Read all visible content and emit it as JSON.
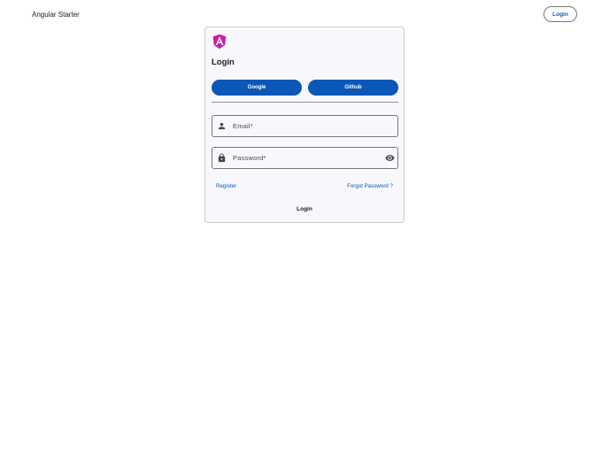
{
  "toolbar": {
    "title": "Angular Starter",
    "login_label": "Login"
  },
  "card": {
    "logo_icon": "angular-logo-icon",
    "title": "Login",
    "social": {
      "google_label": "Google",
      "github_label": "Github"
    },
    "email_field": {
      "label": "Email*",
      "value": "",
      "icon": "person-icon"
    },
    "password_field": {
      "label": "Password*",
      "value": "",
      "icon": "lock-icon",
      "toggle_icon": "eye-icon"
    },
    "register_label": "Register",
    "forgot_label": "Forgot Password ?",
    "login_label": "Login"
  },
  "colors": {
    "primary": "#0b57b7",
    "card_background": "#f8f8fc",
    "outline": "#74777f",
    "logo_magenta": "#e40b7f",
    "logo_purple": "#a635d8"
  }
}
